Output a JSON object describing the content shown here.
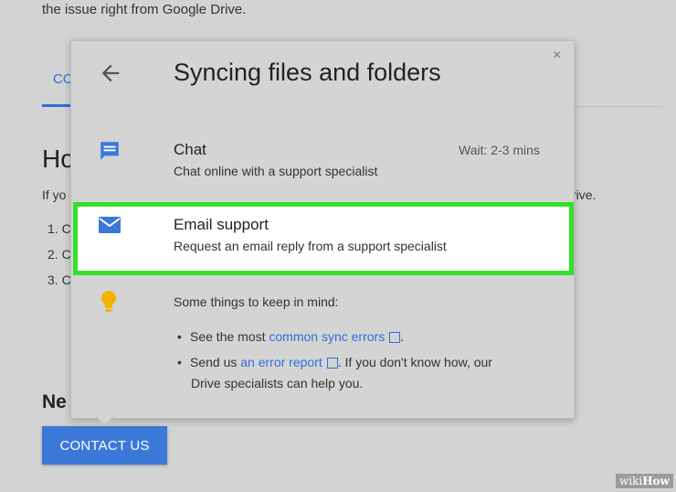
{
  "background": {
    "top_text": "the issue right from Google Drive.",
    "tab_label": "CO",
    "heading": "Ho",
    "intro_start": "If yo",
    "intro_end": "rive.",
    "list_items": [
      "1. C",
      "2. C",
      "3. C"
    ],
    "need_heading": "Ne",
    "contact_button": "CONTACT US"
  },
  "popup": {
    "title": "Syncing files and folders",
    "close_glyph": "×",
    "chat": {
      "icon": "chat-bubble-icon",
      "title": "Chat",
      "description": "Chat online with a support specialist",
      "wait": "Wait: 2-3 mins"
    },
    "email": {
      "icon": "envelope-icon",
      "title": "Email support",
      "description": "Request an email reply from a support specialist"
    },
    "tips": {
      "icon": "lightbulb-icon",
      "title": "Some things to keep in mind:",
      "tip1_prefix": "See the most ",
      "tip1_link": "common sync errors",
      "tip1_suffix": ".",
      "tip2_prefix": "Send us ",
      "tip2_link": "an error report",
      "tip2_suffix": ". If you don't know how, our",
      "tip2_line2": "Drive specialists can help you."
    }
  },
  "watermark": {
    "prefix": "wiki",
    "suffix": "How"
  },
  "colors": {
    "accent": "#3b78d8",
    "highlight": "#33e02a",
    "bulb": "#f2b400"
  }
}
